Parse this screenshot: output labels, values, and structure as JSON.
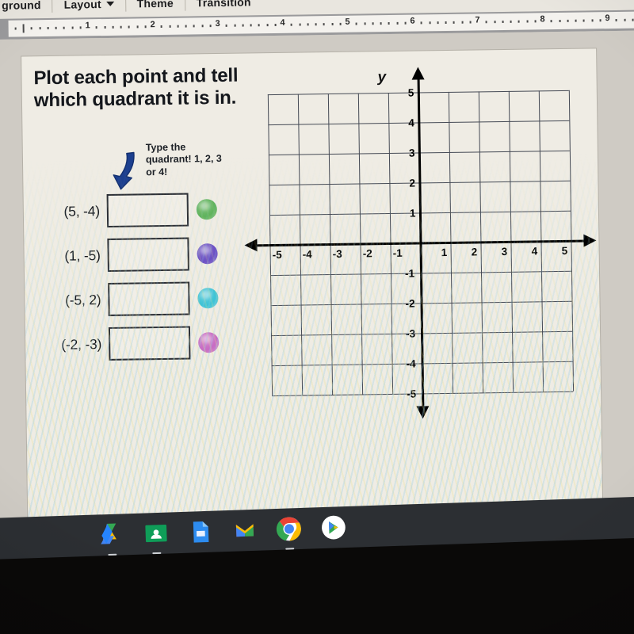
{
  "toolbar": {
    "items": [
      {
        "label": "ground",
        "name": "background-menu",
        "caret": false
      },
      {
        "label": "Layout",
        "name": "layout-menu",
        "caret": true
      },
      {
        "label": "Theme",
        "name": "theme-menu",
        "caret": false
      },
      {
        "label": "Transition",
        "name": "transition-menu",
        "caret": false
      }
    ]
  },
  "ruler": {
    "numbers": [
      "1",
      "2",
      "3",
      "4",
      "5",
      "6",
      "7",
      "8",
      "9"
    ]
  },
  "slide": {
    "heading": "Plot each point and tell which quadrant it is in.",
    "hint": "Type the quadrant! 1, 2, 3 or 4!",
    "arrow_color": "#1c3f8f",
    "rows": [
      {
        "coord": "(5, -4)",
        "answer": "",
        "dot_color": "#5fb35c",
        "dot_name": "marker-dot-green"
      },
      {
        "coord": "(1, -5)",
        "answer": "",
        "dot_color": "#6b4fc4",
        "dot_name": "marker-dot-purple"
      },
      {
        "coord": "(-5, 2)",
        "answer": "",
        "dot_color": "#3cc3d6",
        "dot_name": "marker-dot-cyan"
      },
      {
        "coord": "(-2, -3)",
        "answer": "",
        "dot_color": "#c86bc4",
        "dot_name": "marker-dot-pink"
      }
    ]
  },
  "chart_data": {
    "type": "scatter",
    "title": "",
    "xlabel": "",
    "ylabel": "y",
    "xlim": [
      -5,
      5
    ],
    "ylim": [
      -5,
      5
    ],
    "grid": true,
    "x_ticks": [
      "-5",
      "-4",
      "-3",
      "-2",
      "-1",
      "1",
      "2",
      "3",
      "4",
      "5"
    ],
    "y_ticks": [
      "5",
      "4",
      "3",
      "2",
      "1",
      "-1",
      "-2",
      "-3",
      "-4",
      "-5"
    ],
    "points": [],
    "note": "Empty coordinate grid; student must plot (5,-4), (1,-5), (-5,2), (-2,-3)"
  },
  "shelf": {
    "icons": [
      {
        "name": "google-drive-icon",
        "label": "Google Drive",
        "active": true
      },
      {
        "name": "google-classroom-icon",
        "label": "Classroom",
        "active": true
      },
      {
        "name": "google-slides-icon",
        "label": "Slides",
        "active": false
      },
      {
        "name": "gmail-icon",
        "label": "Gmail",
        "active": false
      },
      {
        "name": "chrome-icon",
        "label": "Chrome",
        "active": true
      },
      {
        "name": "play-store-icon",
        "label": "Play Store",
        "active": false
      }
    ]
  }
}
